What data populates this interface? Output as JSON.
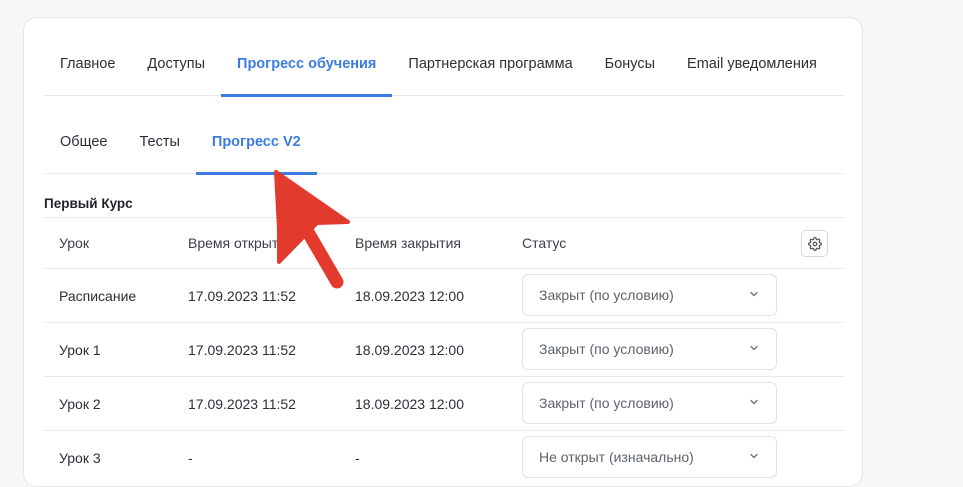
{
  "top_tabs": [
    {
      "label": "Главное",
      "active": false
    },
    {
      "label": "Доступы",
      "active": false
    },
    {
      "label": "Прогресс обучения",
      "active": true
    },
    {
      "label": "Партнерская программа",
      "active": false
    },
    {
      "label": "Бонусы",
      "active": false
    },
    {
      "label": "Email уведомления",
      "active": false
    }
  ],
  "sub_tabs": [
    {
      "label": "Общее",
      "active": false
    },
    {
      "label": "Тесты",
      "active": false
    },
    {
      "label": "Прогресс V2",
      "active": true
    }
  ],
  "course": {
    "title": "Первый Курс",
    "columns": {
      "lesson": "Урок",
      "open_time": "Время открытия",
      "close_time": "Время закрытия",
      "status": "Статус"
    },
    "rows": [
      {
        "lesson": "Расписание",
        "open_time": "17.09.2023 11:52",
        "close_time": "18.09.2023 12:00",
        "status": "Закрыт (по условию)"
      },
      {
        "lesson": "Урок 1",
        "open_time": "17.09.2023 11:52",
        "close_time": "18.09.2023 12:00",
        "status": "Закрыт (по условию)"
      },
      {
        "lesson": "Урок 2",
        "open_time": "17.09.2023 11:52",
        "close_time": "18.09.2023 12:00",
        "status": "Закрыт (по условию)"
      },
      {
        "lesson": "Урок 3",
        "open_time": "-",
        "close_time": "-",
        "status": "Не открыт (изначально)"
      }
    ]
  },
  "icons": {
    "settings": "gear-icon",
    "select_chevron": "chevron-down-icon",
    "annotation": "red-arrow"
  },
  "colors": {
    "accent": "#3b7ce2",
    "annotation_arrow": "#e23b2e"
  }
}
